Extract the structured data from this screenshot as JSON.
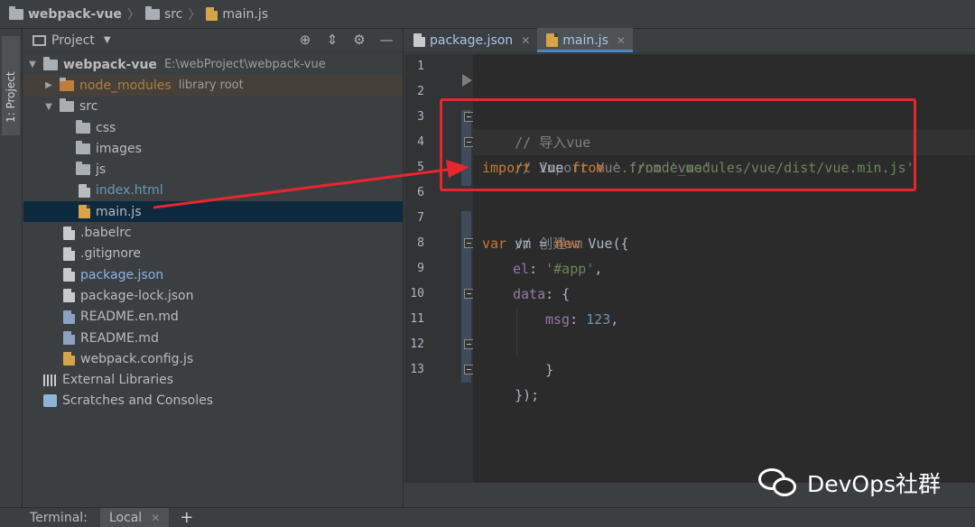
{
  "breadcrumb": {
    "project": "webpack-vue",
    "folder": "src",
    "file": "main.js"
  },
  "sidebar": {
    "strip_label": "1: Project"
  },
  "project_panel": {
    "title": "Project",
    "tree": [
      {
        "label": "webpack-vue",
        "path": "E:\\webProject\\webpack-vue"
      },
      {
        "label": "node_modules",
        "extra": "library root"
      },
      {
        "label": "src"
      },
      {
        "label": "css"
      },
      {
        "label": "images"
      },
      {
        "label": "js"
      },
      {
        "label": "index.html"
      },
      {
        "label": "main.js"
      },
      {
        "label": ".babelrc"
      },
      {
        "label": ".gitignore"
      },
      {
        "label": "package.json"
      },
      {
        "label": "package-lock.json"
      },
      {
        "label": "README.en.md"
      },
      {
        "label": "README.md"
      },
      {
        "label": "webpack.config.js"
      },
      {
        "label": "External Libraries"
      },
      {
        "label": "Scratches and Consoles"
      }
    ]
  },
  "editor": {
    "tabs": [
      {
        "label": "package.json",
        "active": false
      },
      {
        "label": "main.js",
        "active": true
      }
    ],
    "line_numbers": [
      "1",
      "2",
      "3",
      "4",
      "5",
      "6",
      "7",
      "8",
      "9",
      "10",
      "11",
      "12",
      "13"
    ],
    "code": {
      "l3": "// 导入vue",
      "l4": "// import Vue from 'vue'",
      "l5_kw": "import",
      "l5_id": " Vue ",
      "l5_from": "from",
      "l5_str": " '../node_modules/vue/dist/vue.min.js'",
      "l7": "// 创建vm",
      "l8_kw": "var",
      "l8_id": " vm = ",
      "l8_new": "new",
      "l8_rest": " Vue({",
      "l9_prop": "el",
      "l9_colon": ": ",
      "l9_str": "'#app'",
      "l9_end": ",",
      "l10_prop": "data",
      "l10_rest": ": {",
      "l11_prop": "msg",
      "l11_colon": ": ",
      "l11_num": "123",
      "l11_end": ",",
      "l12": "}",
      "l13": "});"
    }
  },
  "terminal": {
    "label": "Terminal:",
    "tab": "Local",
    "add": "+"
  },
  "watermark": "DevOps社群",
  "colors": {
    "annotation_red": "#e8262d",
    "keyword": "#cc7832",
    "string": "#6a8759",
    "comment": "#808080",
    "selection": "#0d293e"
  }
}
